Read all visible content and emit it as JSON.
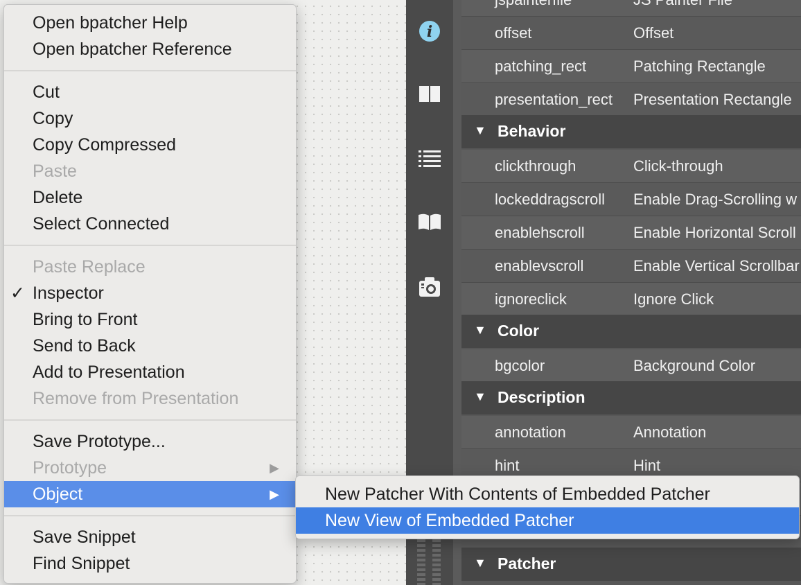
{
  "context_menu": {
    "items": [
      {
        "label": "Open bpatcher Help",
        "enabled": true
      },
      {
        "label": "Open bpatcher Reference",
        "enabled": true
      },
      {
        "label": "Cut",
        "enabled": true
      },
      {
        "label": "Copy",
        "enabled": true
      },
      {
        "label": "Copy Compressed",
        "enabled": true
      },
      {
        "label": "Paste",
        "enabled": false
      },
      {
        "label": "Delete",
        "enabled": true
      },
      {
        "label": "Select Connected",
        "enabled": true
      },
      {
        "label": "Paste Replace",
        "enabled": false
      },
      {
        "label": "Inspector",
        "enabled": true,
        "checked": true
      },
      {
        "label": "Bring to Front",
        "enabled": true
      },
      {
        "label": "Send to Back",
        "enabled": true
      },
      {
        "label": "Add to Presentation",
        "enabled": true
      },
      {
        "label": "Remove from Presentation",
        "enabled": false
      },
      {
        "label": "Save Prototype...",
        "enabled": true
      },
      {
        "label": "Prototype",
        "enabled": false,
        "submenu": true
      },
      {
        "label": "Object",
        "enabled": true,
        "submenu": true,
        "highlighted": true
      },
      {
        "label": "Save Snippet",
        "enabled": true
      },
      {
        "label": "Find Snippet",
        "enabled": true
      }
    ],
    "check_glyph": "✓",
    "submenu_glyph": "▶"
  },
  "submenu": {
    "items": [
      {
        "label": "New Patcher With Contents of Embedded Patcher"
      },
      {
        "label": "New View of Embedded Patcher",
        "highlighted": true
      }
    ]
  },
  "sidebar": {
    "icons": [
      "info-icon",
      "two-panel-icon",
      "list-icon",
      "book-icon",
      "camera-icon"
    ]
  },
  "inspector": {
    "rows_top": [
      {
        "key": "jspainterfile",
        "value": "JS Painter File"
      },
      {
        "key": "offset",
        "value": "Offset"
      },
      {
        "key": "patching_rect",
        "value": "Patching Rectangle"
      },
      {
        "key": "presentation_rect",
        "value": "Presentation Rectangle"
      }
    ],
    "behavior": {
      "title": "Behavior",
      "rows": [
        {
          "key": "clickthrough",
          "value": "Click-through"
        },
        {
          "key": "lockeddragscroll",
          "value": "Enable Drag-Scrolling w"
        },
        {
          "key": "enablehscroll",
          "value": "Enable Horizontal Scroll"
        },
        {
          "key": "enablevscroll",
          "value": "Enable Vertical Scrollbar"
        },
        {
          "key": "ignoreclick",
          "value": "Ignore Click"
        }
      ]
    },
    "color": {
      "title": "Color",
      "rows": [
        {
          "key": "bgcolor",
          "value": "Background Color"
        }
      ]
    },
    "description": {
      "title": "Description",
      "rows": [
        {
          "key": "annotation",
          "value": "Annotation"
        },
        {
          "key": "hint",
          "value": "Hint"
        }
      ]
    },
    "patcher": {
      "title": "Patcher"
    },
    "section_glyph": "▼"
  },
  "colors": {
    "menu_highlight": "#5a8ee8",
    "submenu_highlight": "#3f7fe3",
    "inspector_bg": "#575757",
    "section_bg": "#464646"
  }
}
